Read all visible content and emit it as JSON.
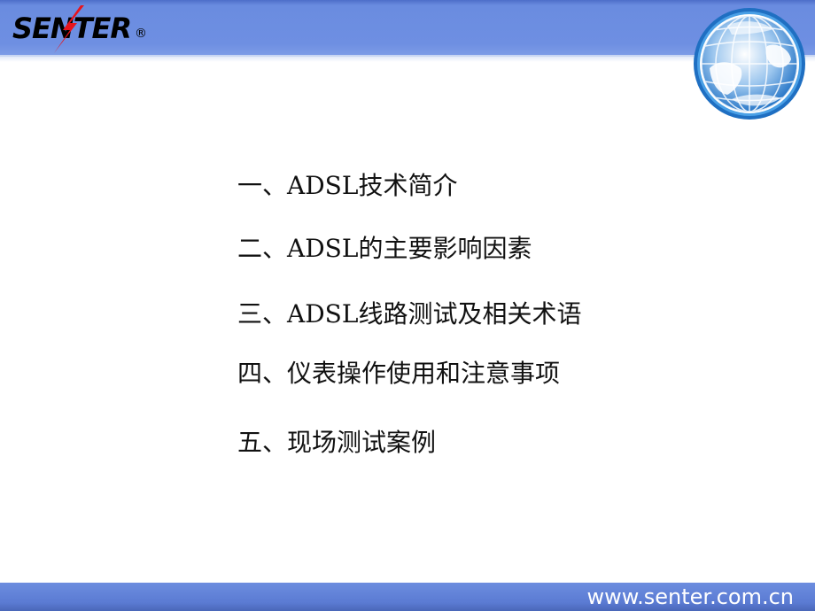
{
  "header": {
    "logo_text": "SENTER",
    "logo_registered": "®",
    "logo_accent_color": "#e8141c",
    "band_color": "#6e8fe2",
    "globe_icon": "globe-icon"
  },
  "agenda": {
    "items": [
      {
        "label": "一、ADSL技术简介"
      },
      {
        "label": "二、ADSL的主要影响因素"
      },
      {
        "label": "三、ADSL线路测试及相关术语"
      },
      {
        "label": "四、仪表操作使用和注意事项"
      },
      {
        "label": "五、现场测试案例"
      }
    ]
  },
  "footer": {
    "url": "www.senter.com.cn"
  }
}
